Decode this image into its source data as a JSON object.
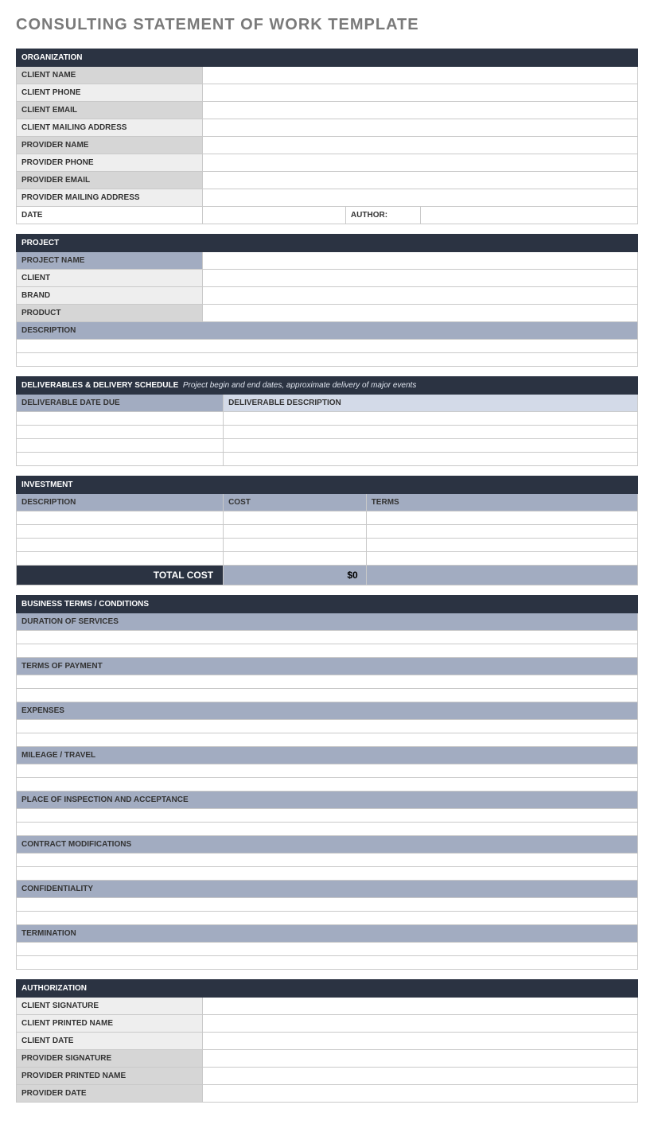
{
  "title": "CONSULTING STATEMENT OF WORK TEMPLATE",
  "organization": {
    "header": "ORGANIZATION",
    "fields": {
      "client_name": "CLIENT NAME",
      "client_phone": "CLIENT  PHONE",
      "client_email": "CLIENT EMAIL",
      "client_mailing": "CLIENT MAILING ADDRESS",
      "provider_name": "PROVIDER NAME",
      "provider_phone": "PROVIDER PHONE",
      "provider_email": "PROVIDER EMAIL",
      "provider_mailing": "PROVIDER MAILING ADDRESS",
      "date": "DATE",
      "author": "AUTHOR:"
    },
    "values": {
      "client_name": "",
      "client_phone": "",
      "client_email": "",
      "client_mailing": "",
      "provider_name": "",
      "provider_phone": "",
      "provider_email": "",
      "provider_mailing": "",
      "date": "",
      "author": ""
    }
  },
  "project": {
    "header": "PROJECT",
    "fields": {
      "project_name": "PROJECT NAME",
      "client": "CLIENT",
      "brand": "BRAND",
      "product": "PRODUCT",
      "description": "DESCRIPTION"
    },
    "values": {
      "project_name": "",
      "client": "",
      "brand": "",
      "product": "",
      "description": ""
    }
  },
  "deliverables": {
    "header": "DELIVERABLES & DELIVERY SCHEDULE",
    "subtext": "Project begin and end dates, approximate delivery of major events",
    "cols": {
      "date": "DELIVERABLE DATE DUE",
      "desc": "DELIVERABLE DESCRIPTION"
    },
    "rows": [
      {
        "date": "",
        "desc": ""
      },
      {
        "date": "",
        "desc": ""
      },
      {
        "date": "",
        "desc": ""
      },
      {
        "date": "",
        "desc": ""
      }
    ]
  },
  "investment": {
    "header": "INVESTMENT",
    "cols": {
      "desc": "DESCRIPTION",
      "cost": "COST",
      "terms": "TERMS"
    },
    "rows": [
      {
        "desc": "",
        "cost": "",
        "terms": ""
      },
      {
        "desc": "",
        "cost": "",
        "terms": ""
      },
      {
        "desc": "",
        "cost": "",
        "terms": ""
      },
      {
        "desc": "",
        "cost": "",
        "terms": ""
      }
    ],
    "total_label": "TOTAL COST",
    "total_value": "$0"
  },
  "terms": {
    "header": "BUSINESS TERMS / CONDITIONS",
    "sections": [
      {
        "label": "DURATION OF SERVICES",
        "value": ""
      },
      {
        "label": "TERMS OF PAYMENT",
        "value": ""
      },
      {
        "label": "EXPENSES",
        "value": ""
      },
      {
        "label": "MILEAGE / TRAVEL",
        "value": ""
      },
      {
        "label": "PLACE OF INSPECTION AND ACCEPTANCE",
        "value": ""
      },
      {
        "label": "CONTRACT MODIFICATIONS",
        "value": ""
      },
      {
        "label": "CONFIDENTIALITY",
        "value": ""
      },
      {
        "label": "TERMINATION",
        "value": ""
      }
    ]
  },
  "authorization": {
    "header": "AUTHORIZATION",
    "fields": {
      "client_sig": "CLIENT SIGNATURE",
      "client_printed": "CLIENT PRINTED NAME",
      "client_date": "CLIENT DATE",
      "provider_sig": "PROVIDER SIGNATURE",
      "provider_printed": "PROVIDER PRINTED NAME",
      "provider_date": "PROVIDER DATE"
    },
    "values": {
      "client_sig": "",
      "client_printed": "",
      "client_date": "",
      "provider_sig": "",
      "provider_printed": "",
      "provider_date": ""
    }
  }
}
